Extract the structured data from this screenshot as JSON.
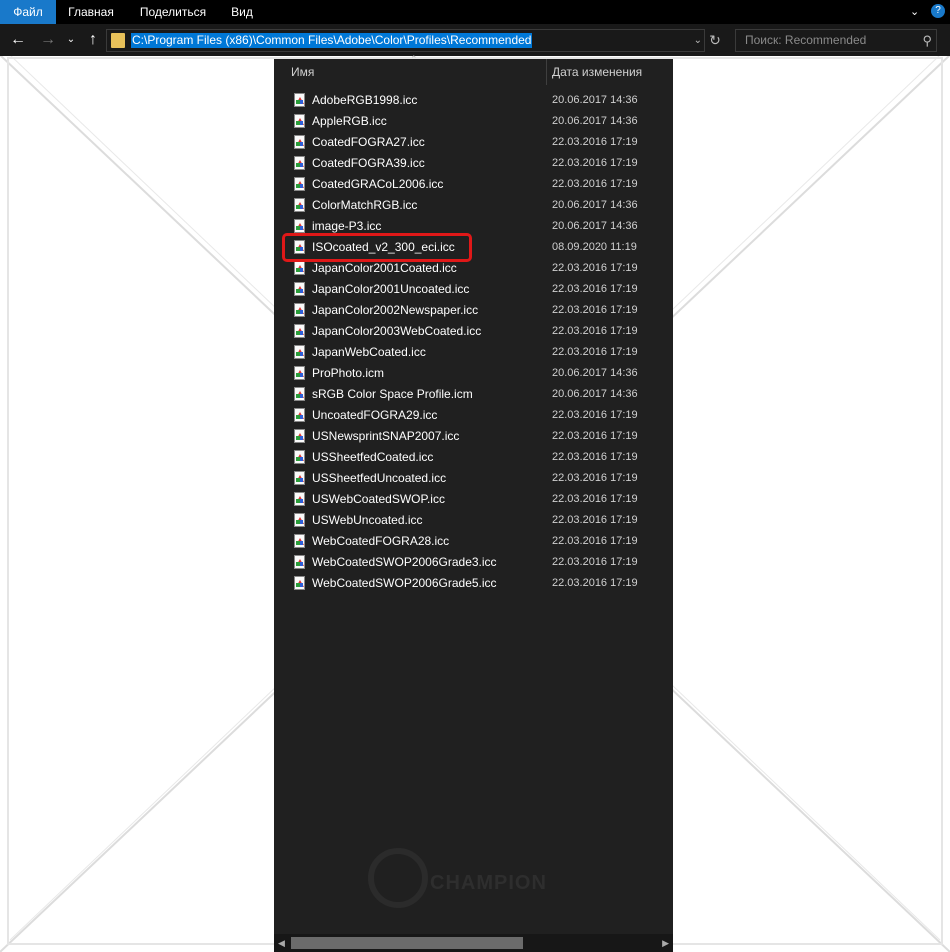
{
  "ribbon": {
    "tabs": [
      {
        "label": "Файл",
        "active": true
      },
      {
        "label": "Главная",
        "active": false
      },
      {
        "label": "Поделиться",
        "active": false
      },
      {
        "label": "Вид",
        "active": false
      }
    ],
    "help_label": "?"
  },
  "navigation": {
    "back_icon": "arrow-left-icon",
    "forward_icon": "arrow-right-icon",
    "recent_icon": "chevron-down-icon",
    "up_icon": "arrow-up-icon",
    "address": "C:\\Program Files (x86)\\Common Files\\Adobe\\Color\\Profiles\\Recommended",
    "search_placeholder": "Поиск: Recommended"
  },
  "file_list": {
    "columns": [
      "Имя",
      "Дата изменения"
    ],
    "files": [
      {
        "name": "AdobeRGB1998.icc",
        "date": "20.06.2017 14:36"
      },
      {
        "name": "AppleRGB.icc",
        "date": "20.06.2017 14:36"
      },
      {
        "name": "CoatedFOGRA27.icc",
        "date": "22.03.2016 17:19"
      },
      {
        "name": "CoatedFOGRA39.icc",
        "date": "22.03.2016 17:19"
      },
      {
        "name": "CoatedGRACoL2006.icc",
        "date": "22.03.2016 17:19"
      },
      {
        "name": "ColorMatchRGB.icc",
        "date": "20.06.2017 14:36"
      },
      {
        "name": "image-P3.icc",
        "date": "20.06.2017 14:36"
      },
      {
        "name": "ISOcoated_v2_300_eci.icc",
        "date": "08.09.2020 11:19"
      },
      {
        "name": "JapanColor2001Coated.icc",
        "date": "22.03.2016 17:19"
      },
      {
        "name": "JapanColor2001Uncoated.icc",
        "date": "22.03.2016 17:19"
      },
      {
        "name": "JapanColor2002Newspaper.icc",
        "date": "22.03.2016 17:19"
      },
      {
        "name": "JapanColor2003WebCoated.icc",
        "date": "22.03.2016 17:19"
      },
      {
        "name": "JapanWebCoated.icc",
        "date": "22.03.2016 17:19"
      },
      {
        "name": "ProPhoto.icm",
        "date": "20.06.2017 14:36"
      },
      {
        "name": "sRGB Color Space Profile.icm",
        "date": "20.06.2017 14:36"
      },
      {
        "name": "UncoatedFOGRA29.icc",
        "date": "22.03.2016 17:19"
      },
      {
        "name": "USNewsprintSNAP2007.icc",
        "date": "22.03.2016 17:19"
      },
      {
        "name": "USSheetfedCoated.icc",
        "date": "22.03.2016 17:19"
      },
      {
        "name": "USSheetfedUncoated.icc",
        "date": "22.03.2016 17:19"
      },
      {
        "name": "USWebCoatedSWOP.icc",
        "date": "22.03.2016 17:19"
      },
      {
        "name": "USWebUncoated.icc",
        "date": "22.03.2016 17:19"
      },
      {
        "name": "WebCoatedFOGRA28.icc",
        "date": "22.03.2016 17:19"
      },
      {
        "name": "WebCoatedSWOP2006Grade3.icc",
        "date": "22.03.2016 17:19"
      },
      {
        "name": "WebCoatedSWOP2006Grade5.icc",
        "date": "22.03.2016 17:19"
      }
    ],
    "highlighted_file": "ISOcoated_v2_300_eci.icc"
  },
  "watermark": {
    "text": "CHAMPION"
  },
  "colors": {
    "accent": "#1979ca",
    "selection": "#0078d7",
    "highlight_box": "#e01818"
  }
}
